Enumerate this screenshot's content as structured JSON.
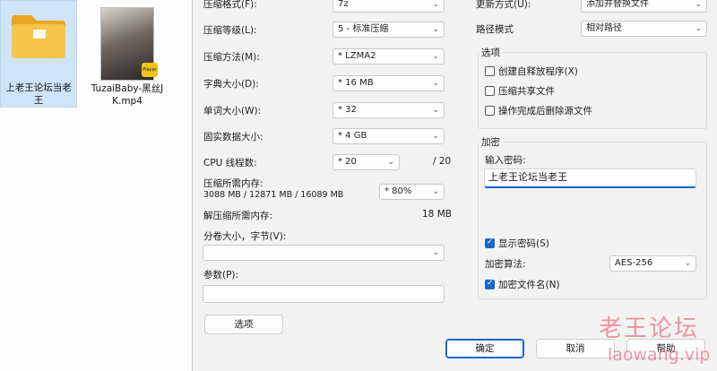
{
  "desktop": {
    "folder_label": "上老王论坛当老王",
    "video_label": "TuzaiBaby-黑丝JK.mp4",
    "video_badge": "Player"
  },
  "left": {
    "format_label": "压缩格式(F):",
    "format_value": "7z",
    "level_label": "压缩等级(L):",
    "level_value": "5 - 标准压缩",
    "method_label": "压缩方法(M):",
    "method_value": "* LZMA2",
    "dict_label": "字典大小(D):",
    "dict_value": "* 16 MB",
    "word_label": "单词大小(W):",
    "word_value": "* 32",
    "solid_label": "固实数据大小:",
    "solid_value": "* 4 GB",
    "cpu_label": "CPU 线程数:",
    "cpu_value": "* 20",
    "cpu_max": "/ 20",
    "mem_label": "压缩所需内存:",
    "mem_detail": "3088 MB / 12871 MB / 16089 MB",
    "mem_value": "* 80%",
    "decomp_label": "解压缩所需内存:",
    "decomp_value": "18 MB",
    "volume_label": "分卷大小，字节(V):",
    "volume_value": "",
    "params_label": "参数(P):",
    "params_value": "",
    "options_button": "选项"
  },
  "right": {
    "update_label": "更新方式(U):",
    "update_value": "添加并替换文件",
    "path_label": "路径模式",
    "path_value": "相对路径",
    "options_title": "选项",
    "opt_sfx": "创建自释放程序(X)",
    "opt_shared": "压缩共享文件",
    "opt_delete": "操作完成后删除源文件",
    "enc_title": "加密",
    "pwd_label": "输入密码:",
    "pwd_value": "上老王论坛当老王",
    "show_pwd": "显示密码(S)",
    "algo_label": "加密算法:",
    "algo_value": "AES-256",
    "enc_names": "加密文件名(N)"
  },
  "buttons": {
    "ok": "确定",
    "cancel": "取消",
    "help": "帮助"
  },
  "watermark": {
    "cn": "老王论坛",
    "url": "laowang.vip"
  }
}
